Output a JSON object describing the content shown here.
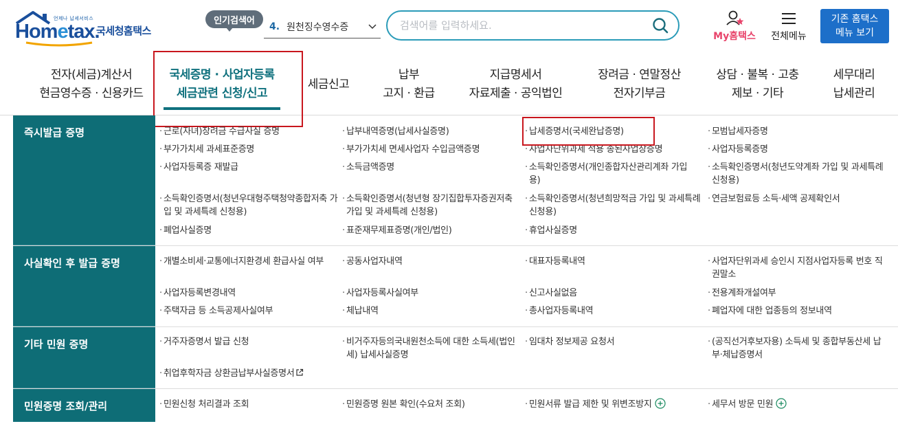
{
  "header": {
    "logo_sub": "언제나 납세서비스",
    "logo_word_a": "Hom",
    "logo_word_e": "e",
    "logo_word_b": "tax.",
    "logo_name": "국세청홈택스",
    "popular_label": "인기검색어",
    "keyword_rank": "4.",
    "keyword_text": "원천징수영수증",
    "search_placeholder": "검색어를 입력하세요.",
    "my_label": "My홈택스",
    "menu_label": "전체메뉴",
    "old_home_line1": "기존 홈택스",
    "old_home_line2": "메뉴 보기",
    "colors": {
      "brand": "#1a4f9c",
      "accent": "#10717e",
      "search_border": "#2a9bb8",
      "my": "#e8446b",
      "button": "#1d6fc9",
      "highlight": "#c8161d"
    }
  },
  "nav": [
    {
      "line1": "전자(세금)계산서",
      "line2": "현금영수증 · 신용카드"
    },
    {
      "line1": "국세증명 · 사업자등록",
      "line2": "세금관련 신청/신고",
      "active": true
    },
    {
      "line1": "세금신고",
      "line2": ""
    },
    {
      "line1": "납부",
      "line2": "고지 · 환급"
    },
    {
      "line1": "지급명세서",
      "line2": "자료제출 · 공익법인"
    },
    {
      "line1": "장려금 · 연말정산",
      "line2": "전자기부금"
    },
    {
      "line1": "상담 · 불복 · 고충",
      "line2": "제보 · 기타"
    },
    {
      "line1": "세무대리",
      "line2": "납세관리"
    }
  ],
  "sections": [
    {
      "title": "즉시발급 증명",
      "items": [
        [
          "근로(자녀)장려금 수급사실 증명",
          "납부내역증명(납세사실증명)",
          "납세증명서(국세완납증명)",
          "모범납세자증명"
        ],
        [
          "부가가치세 과세표준증명",
          "부가가치세 면세사업자 수입금액증명",
          "사업자단위과세 적용 종된사업장증명",
          "사업자등록증명"
        ],
        [
          "사업자등록증 재발급",
          "소득금액증명",
          "소득확인증명서(개인종합자산관리계좌 가입용)",
          "소득확인증명서(청년도약계좌 가입 및 과세특례 신청용)"
        ],
        [
          "소득확인증명서(청년우대형주택청약종합저축 가입 및 과세특례 신청용)",
          "소득확인증명서(청년형 장기집합투자증권저축 가입 및 과세특례 신청용)",
          "소득확인증명서(청년희망적금 가입 및 과세특례 신청용)",
          "연금보험료등 소득·세액 공제확인서"
        ],
        [
          "폐업사실증명",
          "표준재무제표증명(개인/법인)",
          "휴업사실증명",
          ""
        ]
      ]
    },
    {
      "title": "사실확인 후 발급 증명",
      "items": [
        [
          "개별소비세·교통에너지환경세 환급사실 여부",
          "공동사업자내역",
          "대표자등록내역",
          "사업자단위과세 승인시 지점사업자등록 번호 직권말소"
        ],
        [
          "사업자등록변경내역",
          "사업자등록사실여부",
          "신고사실없음",
          "전용계좌개설여부"
        ],
        [
          "주택자금 등 소득공제사실여부",
          "체납내역",
          "총사업자등록내역",
          "폐업자에 대한 업종등의 정보내역"
        ]
      ]
    },
    {
      "title": "기타 민원 증명",
      "items": [
        [
          "거주자증명서 발급 신청",
          "비거주자등의국내원천소득에 대한 소득세(법인세) 납세사실증명",
          "임대차 정보제공 요청서",
          "(공직선거후보자용) 소득세 및 종합부동산세 납부·체납증명서"
        ],
        [
          "취업후학자금 상환금납부사실증명서",
          "",
          "",
          ""
        ]
      ]
    },
    {
      "title": "민원증명 조회/관리",
      "items": [
        [
          "민원신청 처리결과 조회",
          "민원증명 원본 확인(수요처 조회)",
          "민원서류 발급 제한 및 위변조방지",
          "세무서 방문 민원"
        ]
      ]
    }
  ]
}
